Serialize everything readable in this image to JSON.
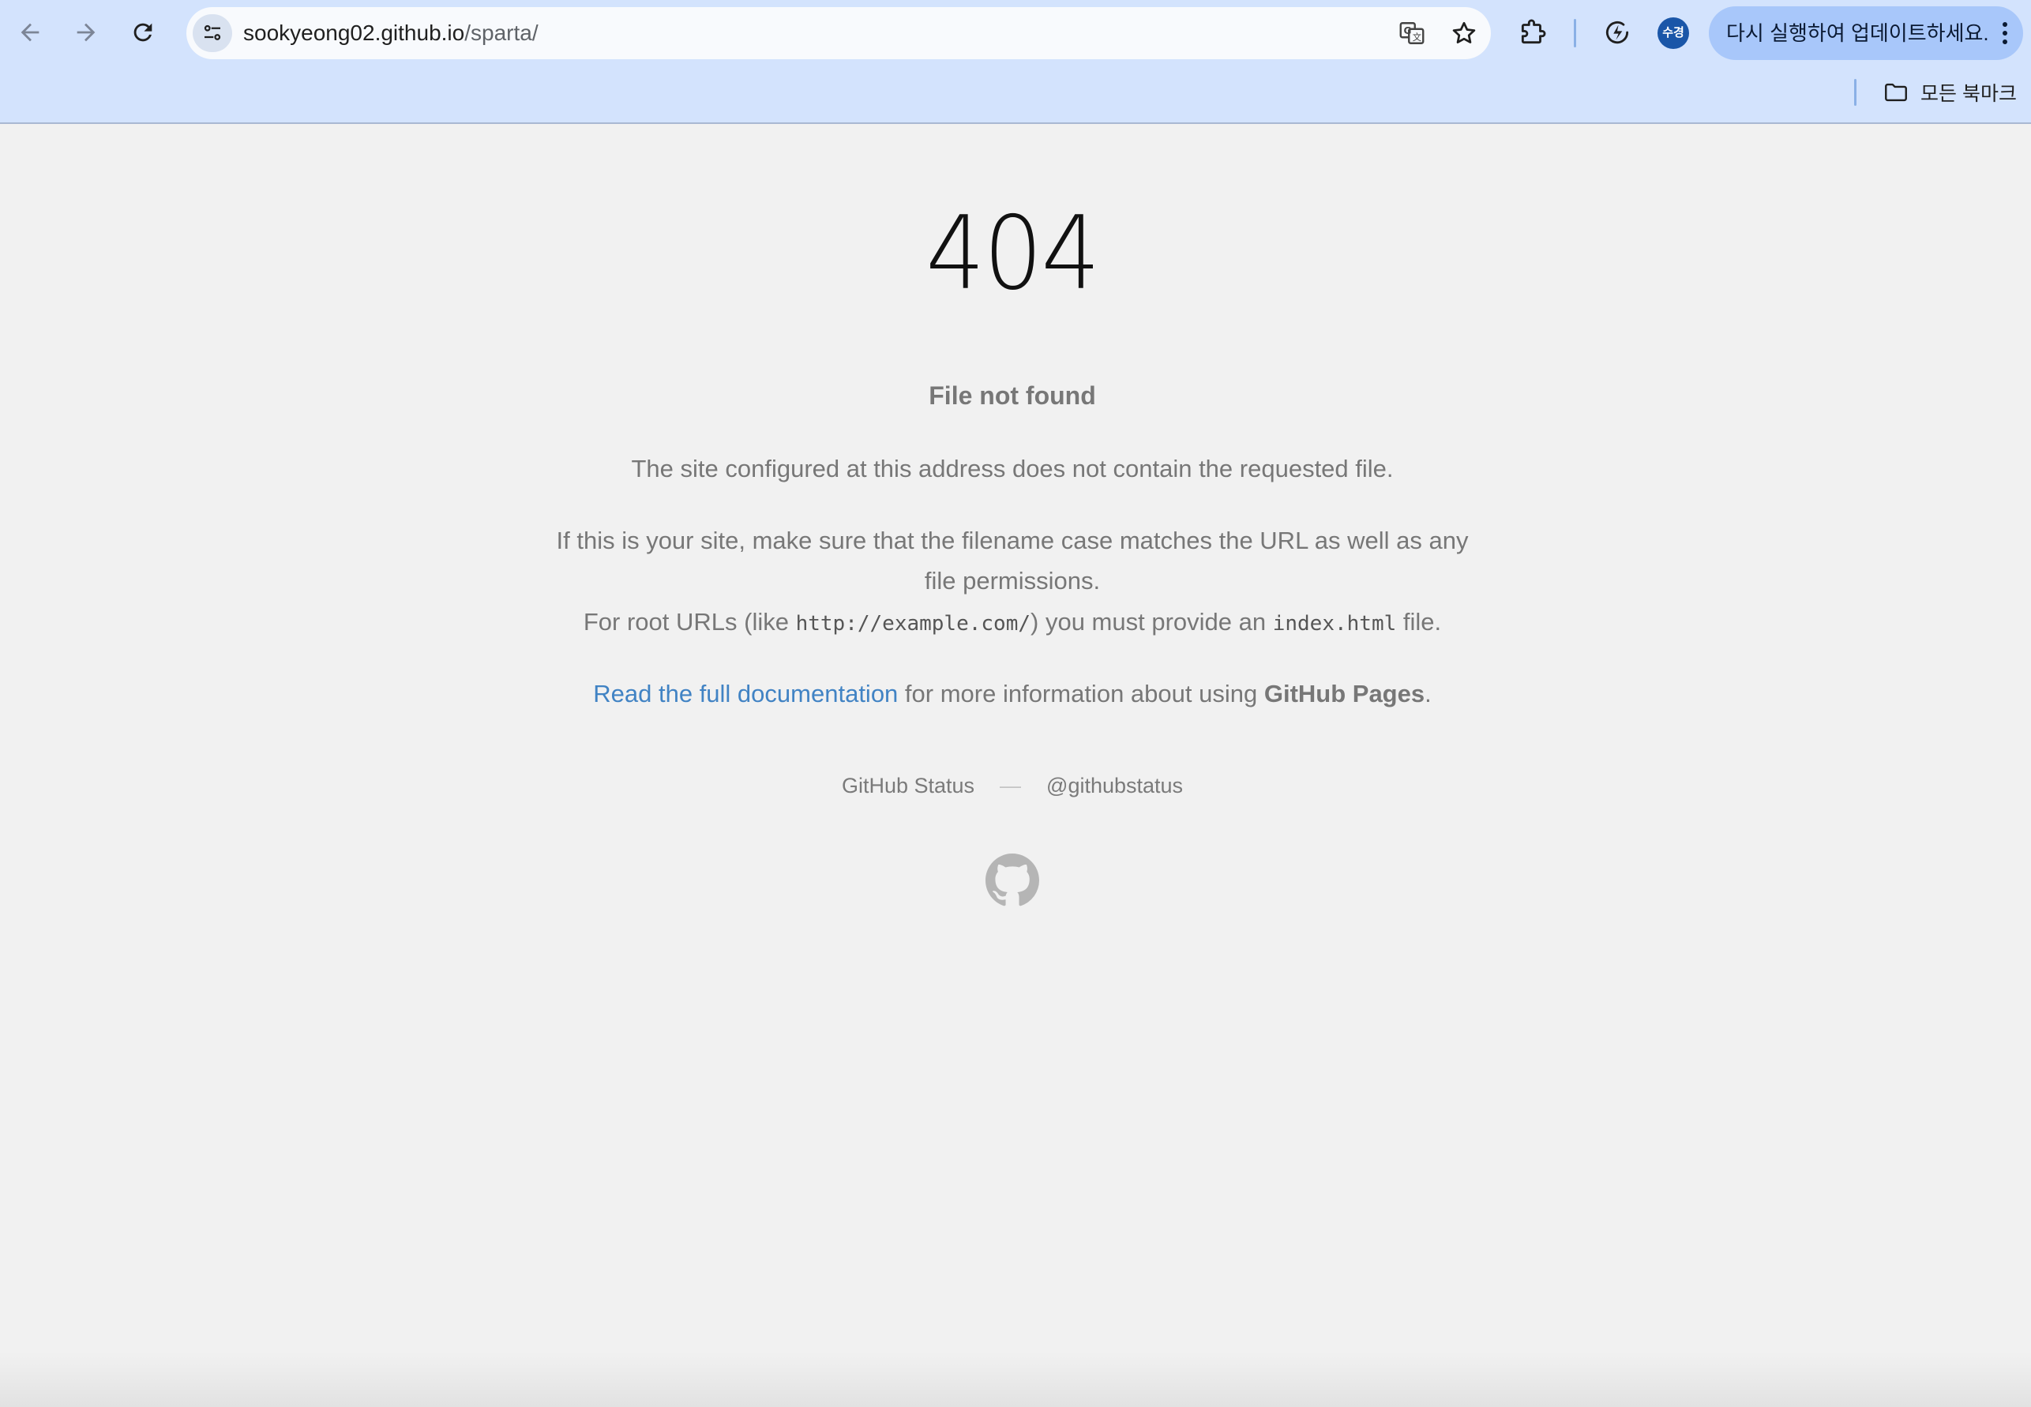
{
  "browser": {
    "url_host": "sookyeong02.github.io",
    "url_path": "/sparta/",
    "profile_initials": "수경",
    "update_label": "다시 실행하여 업데이트하세요.",
    "bookmarks_all_label": "모든 북마크",
    "icons": [
      "back-arrow-icon",
      "forward-arrow-icon",
      "reload-icon",
      "site-info-icon",
      "translate-icon",
      "star-icon",
      "extensions-icon",
      "performance-icon",
      "more-vert-icon",
      "folder-icon"
    ]
  },
  "page": {
    "status_code": "404",
    "title": "File not found",
    "line1": "The site configured at this address does not contain the requested file.",
    "line2a": "If this is your site, make sure that the filename case matches the URL as well as any",
    "line2b": "file permissions.",
    "line3_pre": "For root URLs (like ",
    "line3_code1": "http://example.com/",
    "line3_mid": ") you must provide an ",
    "line3_code2": "index.html",
    "line3_post": " file.",
    "doc_link": "Read the full documentation",
    "doc_mid": " for more information about using ",
    "doc_brand": "GitHub Pages",
    "doc_end": ".",
    "footer_status": "GitHub Status",
    "footer_dash": "—",
    "footer_twitter": "@githubstatus",
    "logo_icon": "github-octocat-icon"
  },
  "colors": {
    "chrome_bg": "#d3e3fd",
    "update_btn_bg": "#a8c7fa",
    "page_bg": "#f1f1f1",
    "link": "#4183c4",
    "text": "#777777"
  }
}
